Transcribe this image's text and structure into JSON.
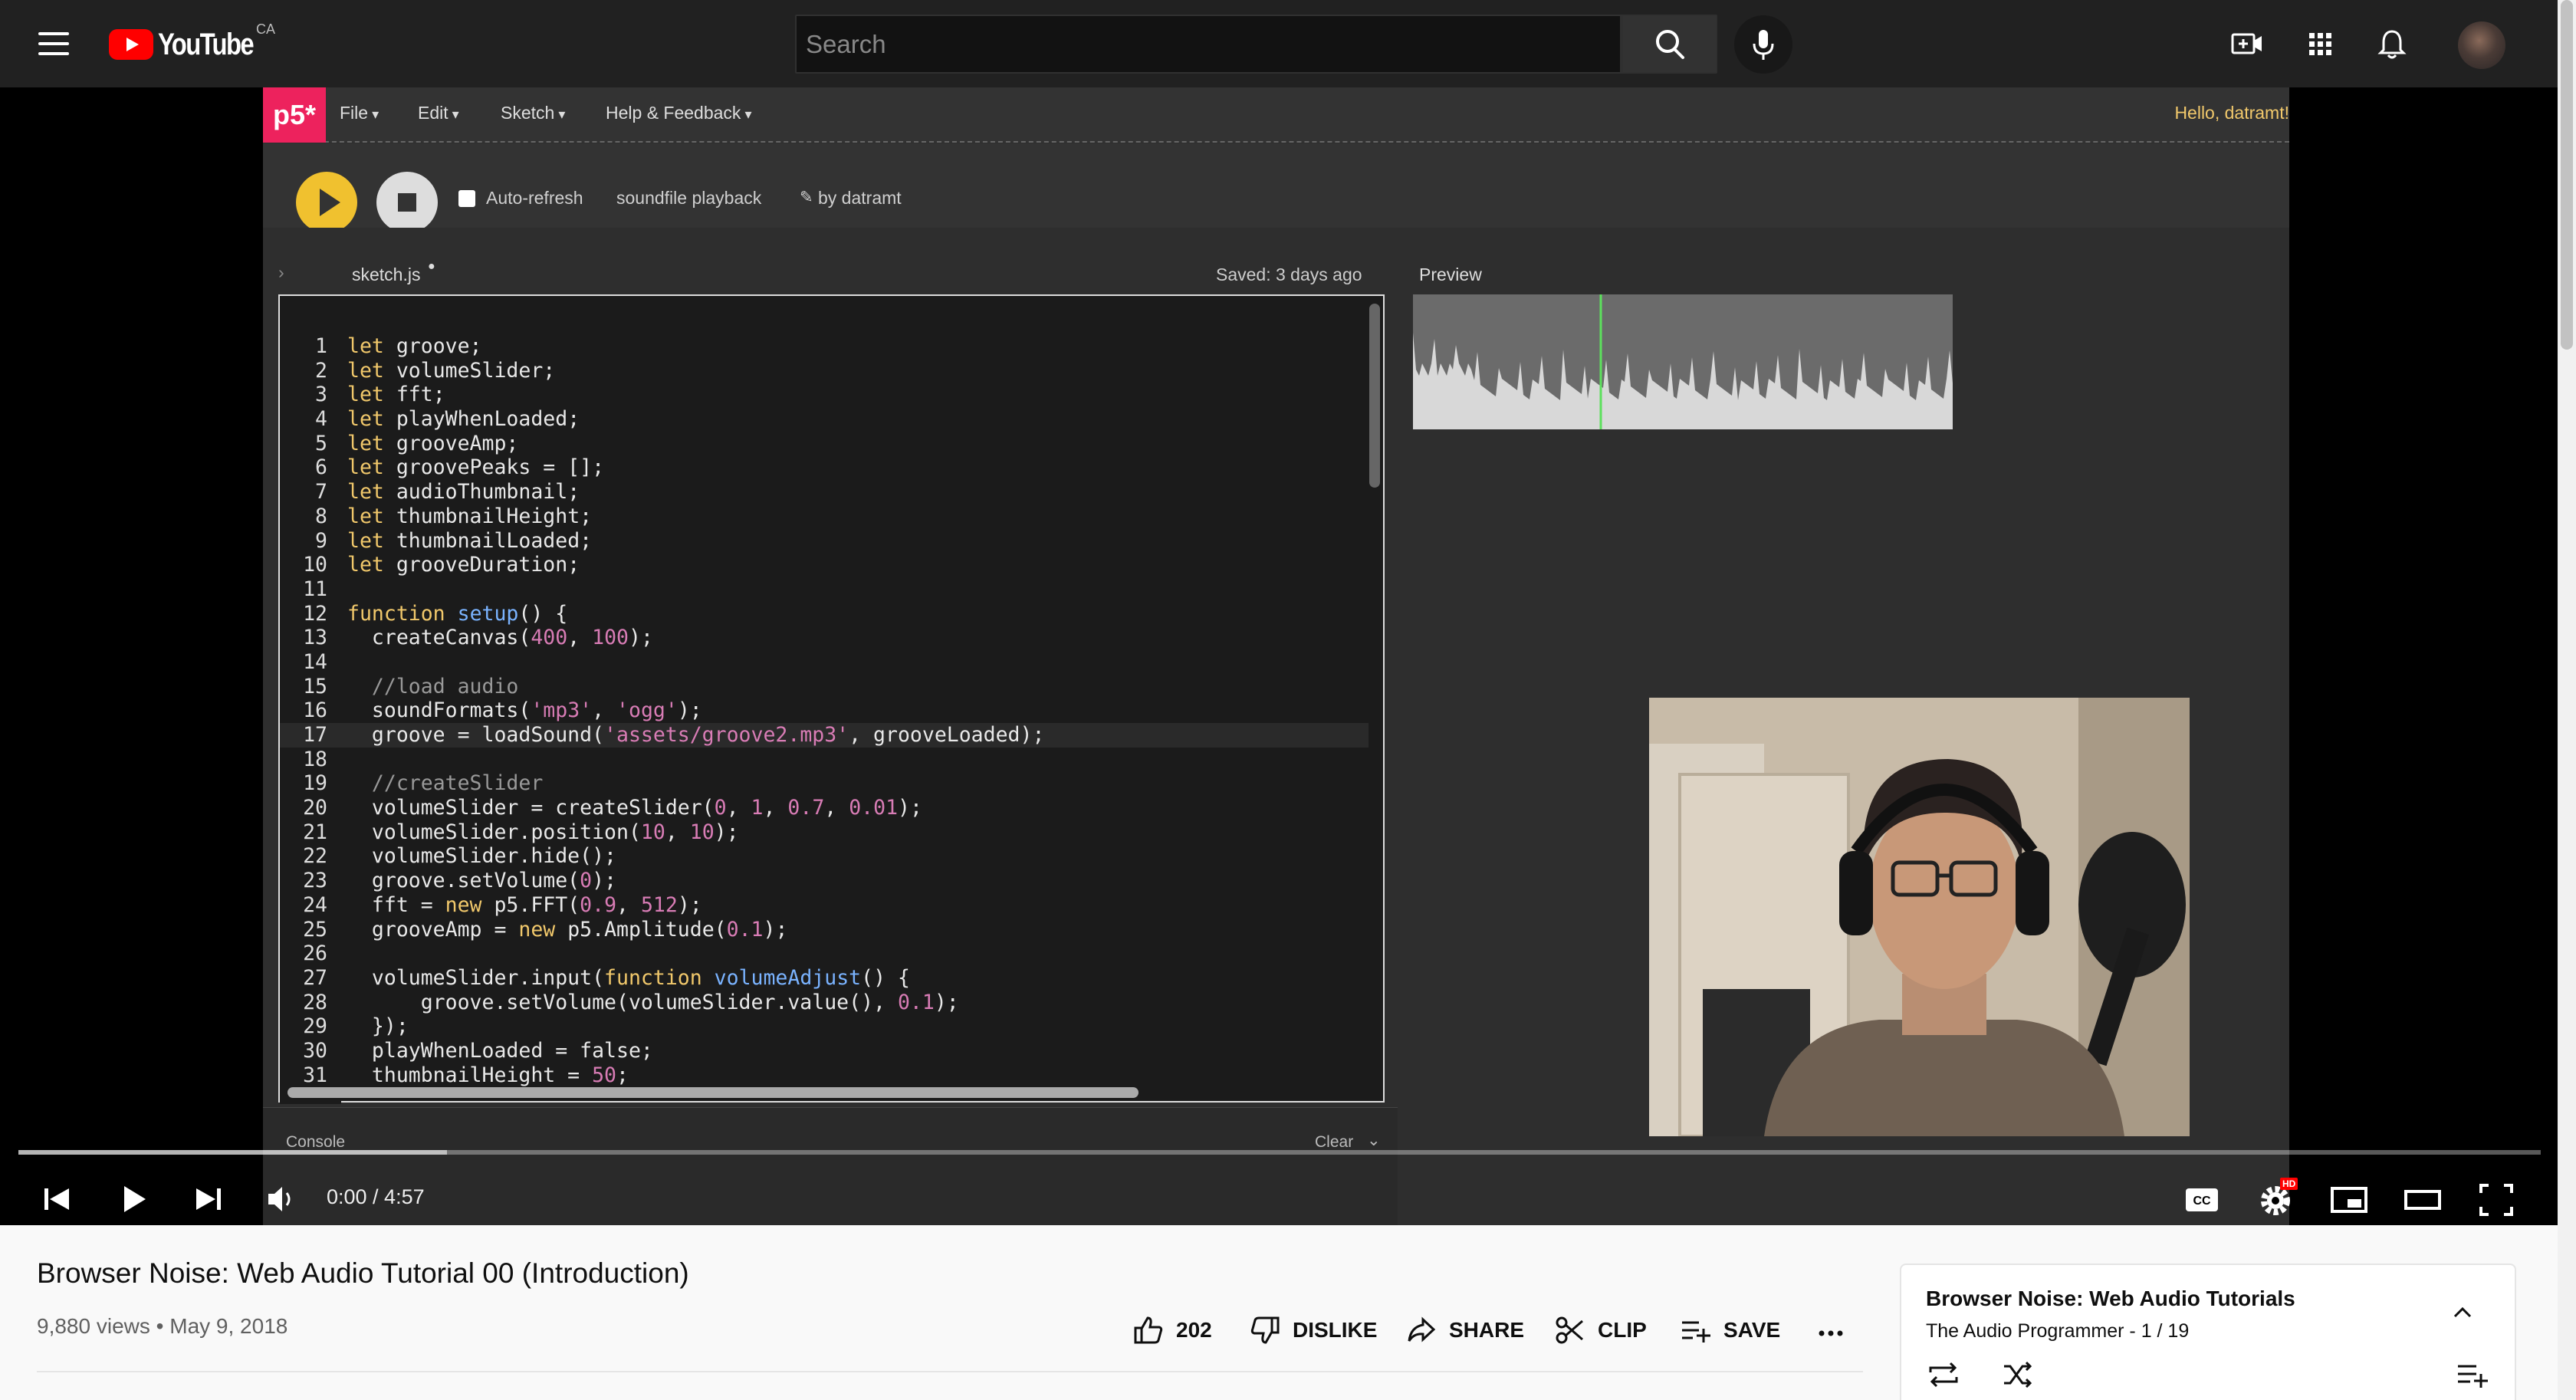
{
  "masthead": {
    "logo_text": "YouTube",
    "country_code": "CA",
    "search_placeholder": "Search",
    "icons": [
      "menu-icon",
      "search-icon",
      "microphone-icon",
      "create-video-icon",
      "apps-icon",
      "notifications-icon",
      "avatar"
    ]
  },
  "p5": {
    "logo": "p5*",
    "menus": [
      "File",
      "Edit",
      "Sketch",
      "Help & Feedback"
    ],
    "hello": "Hello, datramt!",
    "auto_refresh": "Auto-refresh",
    "sketch_name": "soundfile playback",
    "by": "by datramt",
    "file_name": "sketch.js",
    "saved": "Saved: 3 days ago",
    "preview": "Preview",
    "console": "Console",
    "clear": "Clear"
  },
  "code": [
    "let groove;",
    "let volumeSlider;",
    "let fft;",
    "let playWhenLoaded;",
    "let grooveAmp;",
    "let groovePeaks = [];",
    "let audioThumbnail;",
    "let thumbnailHeight;",
    "let thumbnailLoaded;",
    "let grooveDuration;",
    "",
    "function setup() {",
    "  createCanvas(400, 100);",
    "",
    "  //load audio",
    "  soundFormats('mp3', 'ogg');",
    "  groove = loadSound('assets/groove2.mp3', grooveLoaded);",
    "",
    "  //createSlider",
    "  volumeSlider = createSlider(0, 1, 0.7, 0.01);",
    "  volumeSlider.position(10, 10);",
    "  volumeSlider.hide();",
    "  groove.setVolume(0);",
    "  fft = new p5.FFT(0.9, 512);",
    "  grooveAmp = new p5.Amplitude(0.1);",
    "",
    "  volumeSlider.input(function volumeAdjust() {",
    "      groove.setVolume(volumeSlider.value(), 0.1);",
    "  });",
    "  playWhenLoaded = false;",
    "  thumbnailHeight = 50;"
  ],
  "player": {
    "time": "0:00 / 4:57",
    "progress": 0,
    "buffered": 0.17,
    "hd_badge": "HD",
    "icons": [
      "previous-icon",
      "play-icon",
      "next-icon",
      "volume-icon",
      "captions-icon",
      "settings-icon",
      "miniplayer-icon",
      "theater-icon",
      "fullscreen-icon"
    ]
  },
  "video": {
    "title": "Browser Noise: Web Audio Tutorial 00 (Introduction)",
    "views": "9,880 views",
    "date": "May 9, 2018",
    "likes": "202",
    "dislike": "DISLIKE",
    "share": "SHARE",
    "clip": "CLIP",
    "save": "SAVE"
  },
  "playlist": {
    "title": "Browser Noise: Web Audio Tutorials",
    "channel": "The Audio Programmer",
    "position": "1 / 19"
  },
  "colors": {
    "youtube_red": "#ff0000",
    "p5_pink": "#ed225d",
    "p5_yellow": "#f0c12f",
    "masthead_bg": "#212121"
  }
}
